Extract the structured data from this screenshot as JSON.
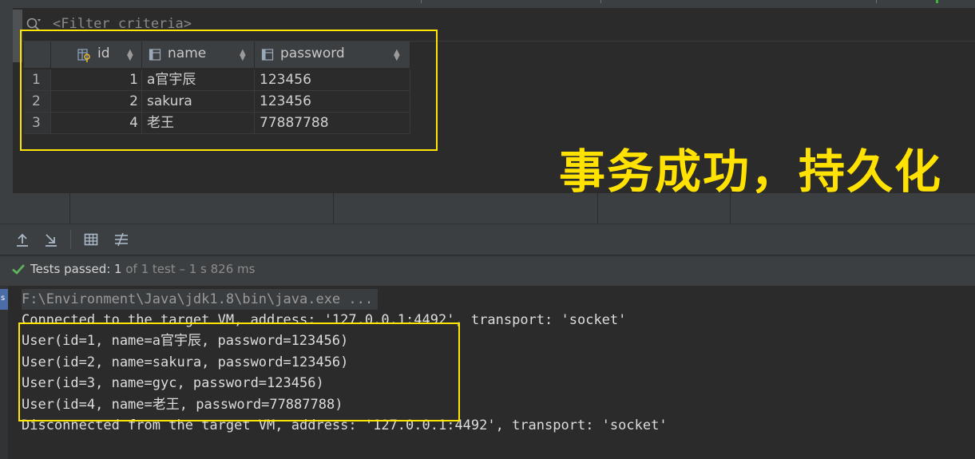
{
  "filter": {
    "placeholder": "<Filter criteria>"
  },
  "table": {
    "columns": [
      {
        "label": "id"
      },
      {
        "label": "name"
      },
      {
        "label": "password"
      }
    ],
    "rows": [
      {
        "num": "1",
        "id": "1",
        "name": "a官宇辰",
        "password": "123456"
      },
      {
        "num": "2",
        "id": "2",
        "name": "sakura",
        "password": "123456"
      },
      {
        "num": "3",
        "id": "4",
        "name": "老王",
        "password": "77887788"
      }
    ]
  },
  "annotation": {
    "text": "事务成功，持久化",
    "color": "#ffe200"
  },
  "status": {
    "label": "Tests passed: ",
    "count": "1",
    "suffix": " of 1 test – 1 s 826 ms",
    "color": "#5fb65f"
  },
  "console": {
    "gutter_mark": "s",
    "lines": [
      "F:\\Environment\\Java\\jdk1.8\\bin\\java.exe ...",
      "Connected to the target VM, address: '127.0.0.1:4492', transport: 'socket'",
      "User(id=1, name=a官宇辰, password=123456)",
      "User(id=2, name=sakura, password=123456)",
      "User(id=3, name=gyc, password=123456)",
      "User(id=4, name=老王, password=77887788)",
      "Disconnected from the target VM, address: '127.0.0.1:4492', transport: 'socket'"
    ]
  },
  "icons": {
    "filter": "search-icon",
    "toolbar": [
      "export-icon",
      "import-icon",
      "grid-view-icon",
      "settings-lines-icon"
    ],
    "status": "check-icon"
  },
  "highlight_color": "#ffe500"
}
